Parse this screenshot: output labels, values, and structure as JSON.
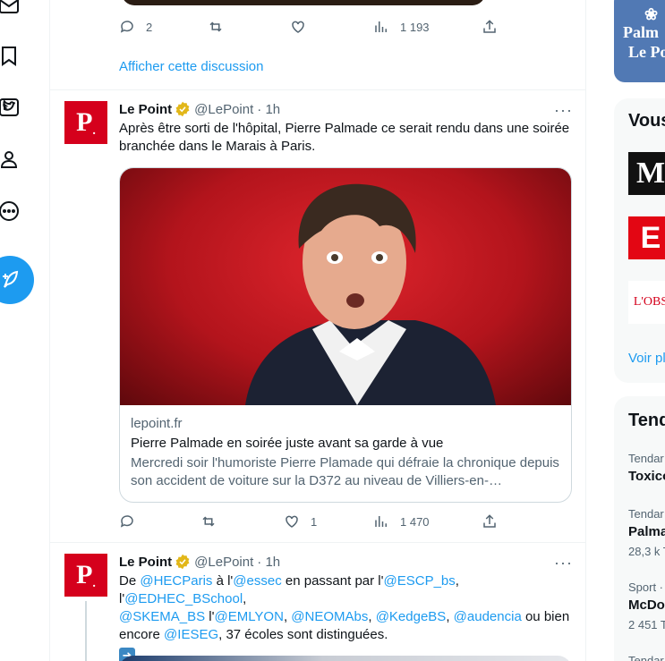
{
  "nav": {
    "items": [
      {
        "icon": "mail-icon"
      },
      {
        "icon": "bookmark-icon"
      },
      {
        "icon": "twitter-blue-icon"
      },
      {
        "icon": "profile-icon"
      },
      {
        "icon": "more-circle-icon"
      }
    ],
    "compose_icon": "compose-tweet-icon"
  },
  "previous_tweet": {
    "replies": "2",
    "retweets": "",
    "likes": "",
    "views": "1 193",
    "show_thread": "Afficher cette discussion"
  },
  "tweets": [
    {
      "author": "Le Point",
      "handle": "@LePoint",
      "time": "· 1h",
      "avatar_letter": "P",
      "text": "Après être sorti de l'hôpital, Pierre Palmade ce serait rendu dans une soirée branchée dans le Marais à Paris.",
      "card": {
        "domain": "lepoint.fr",
        "title": "Pierre Palmade en soirée juste avant sa garde à vue",
        "description": "Mercredi soir l'humoriste Pierre Plamade qui défraie la chronique depuis son accident de voiture sur la D372 au niveau de Villiers-en-…"
      },
      "replies": "",
      "retweets": "",
      "likes": "1",
      "views": "1 470"
    },
    {
      "author": "Le Point",
      "handle": "@LePoint",
      "time": "· 1h",
      "avatar_letter": "P",
      "text_parts": {
        "p1": "De ",
        "m1": "@HECParis",
        "p2": " à l'",
        "m2": "@essec",
        "p3": " en passant par l'",
        "m3": "@ESCP_bs",
        "p4": ", l'",
        "m4": "@EDHEC_BSchool",
        "p5": ",",
        "m5": "@SKEMA_BS",
        "p6": " l'",
        "m6": "@EMLYON",
        "p7": ", ",
        "m7": "@NEOMAbs",
        "p8": ", ",
        "m8": "@KedgeBS",
        "p9": ", ",
        "m9": "@audencia",
        "p10": " ou bien encore ",
        "m10": "@IESEG",
        "p11": ", 37 écoles sont distinguées."
      }
    }
  ],
  "sidebar": {
    "promo": {
      "line1": "Palm",
      "line2": "Le Po"
    },
    "who_to_follow": {
      "title": "Vous",
      "logos": [
        "M",
        "E",
        "L'OBS"
      ],
      "see_more": "Voir pl"
    },
    "trends": {
      "title": "Tend",
      "items": [
        {
          "category": "Tendar",
          "name": "Toxico",
          "count": ""
        },
        {
          "category": "Tendar",
          "name": "Palma",
          "count": "28,3 k T"
        },
        {
          "category": "Sport ·",
          "name": "McDo",
          "count": "2 451 T"
        },
        {
          "category": "Tendar",
          "name": "",
          "count": ""
        }
      ]
    }
  },
  "colors": {
    "accent": "#1d9bf0",
    "lepoint_red": "#d5001c",
    "text_secondary": "#536471"
  }
}
